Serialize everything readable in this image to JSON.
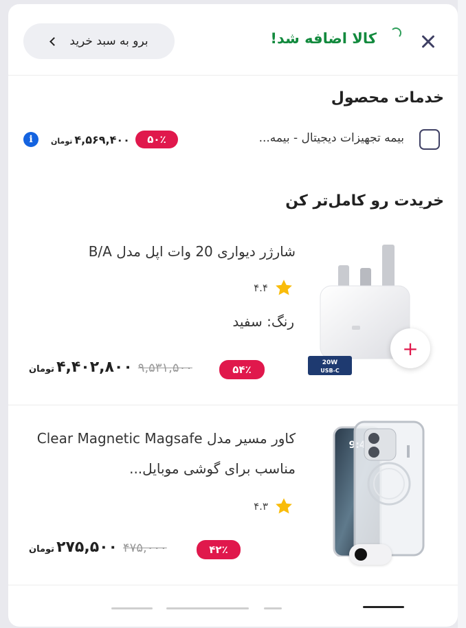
{
  "header": {
    "added_message": "کالا اضافه شد!",
    "go_to_cart": "برو به سبد خرید"
  },
  "services": {
    "title": "خدمات محصول",
    "item": {
      "label": "بیمه تجهیزات دیجیتال - بیمه...",
      "discount": "۵۰٪",
      "price": "۴,۵۶۹,۴۰۰",
      "currency": "تومان",
      "checked": false
    }
  },
  "upsell": {
    "title": "خریدت رو کامل‌تر کن",
    "products": [
      {
        "name": "شارژر دیواری 20 وات اپل مدل B/A",
        "rating": "۴.۴",
        "color_label": "رنگ: سفید",
        "discount": "۵۴٪",
        "old_price": "۹,۵۳۱,۵۰۰",
        "price": "۴,۴۰۲,۸۰۰",
        "currency": "تومان",
        "image_badge": "20W USB-C"
      },
      {
        "name": "کاور مسیر مدل Clear Magnetic Magsafe مناسب برای گوشی موبایل...",
        "rating": "۴.۳",
        "discount": "۴۲٪",
        "old_price": "۴۷۵,۰۰۰",
        "price": "۲۷۵,۵۰۰",
        "currency": "تومان"
      }
    ]
  },
  "colors": {
    "success": "#138a3e",
    "discount": "#e0184c",
    "info": "#1463e0",
    "star": "#f9bc0b"
  }
}
